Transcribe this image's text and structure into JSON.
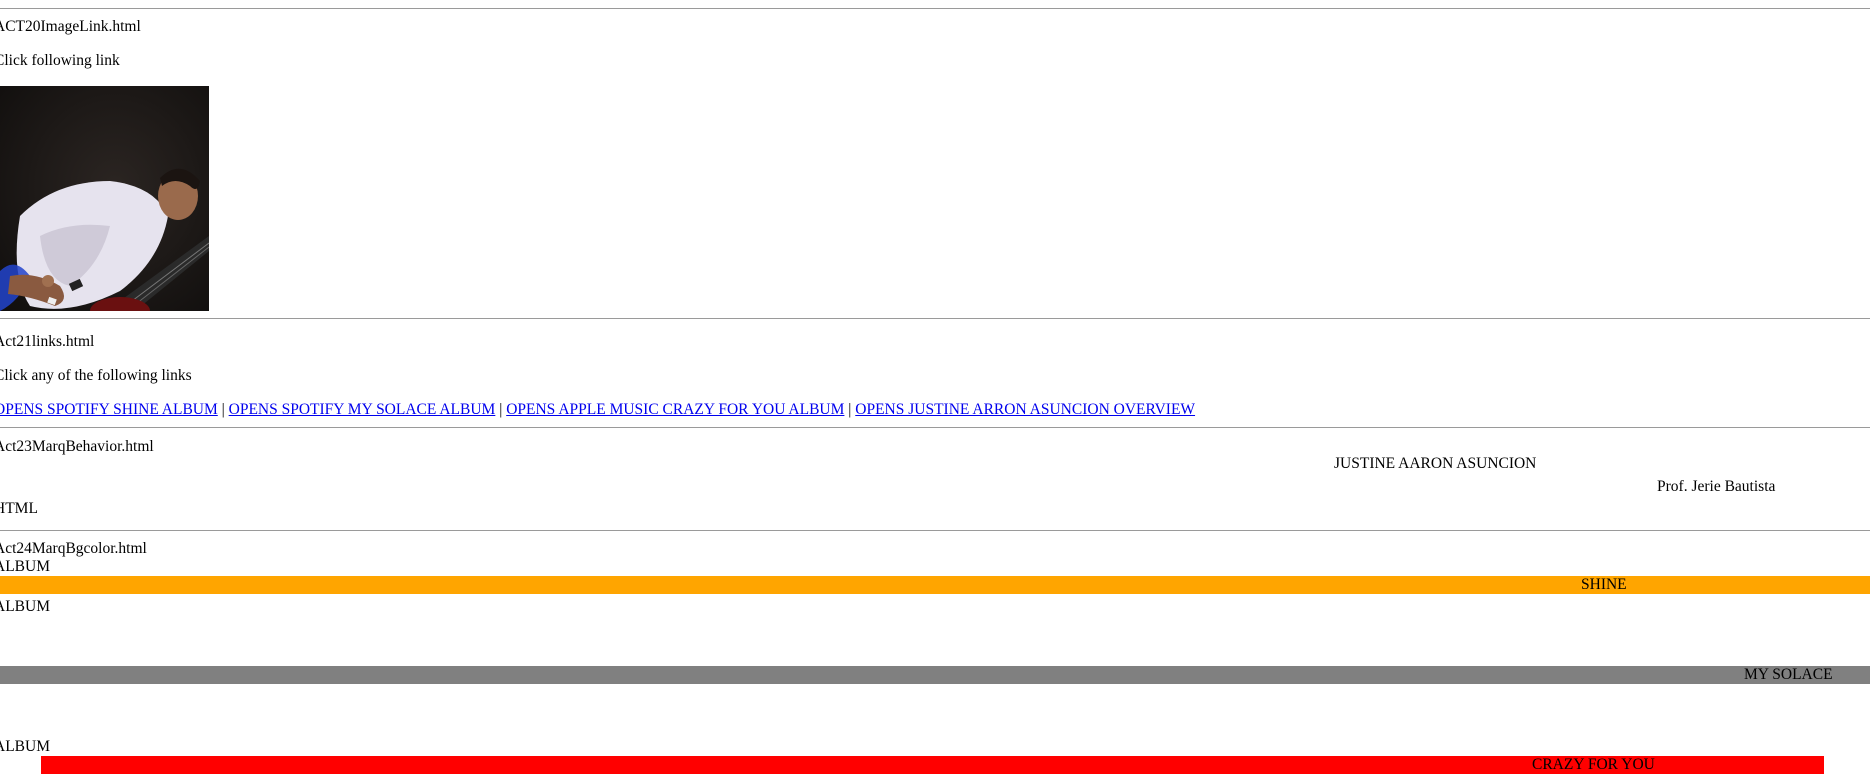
{
  "sections": {
    "s20": {
      "filename": "ACT20ImageLink.html",
      "instruction": "Click following link",
      "image_alt": "artist-photo"
    },
    "s21": {
      "filename": "Act21links.html",
      "instruction": "Click any of the following links",
      "links": [
        "OPENS SPOTIFY SHINE ALBUM",
        "OPENS SPOTIFY MY SOLACE ALBUM",
        "OPENS APPLE MUSIC CRAZY FOR YOU ALBUM",
        "OPENS JUSTINE ARRON ASUNCION OVERVIEW"
      ],
      "separator": "|"
    },
    "s23": {
      "filename": "Act23MarqBehavior.html",
      "marquee_1": "JUSTINE AARON ASUNCION",
      "marquee_2": "Prof. Jerie Bautista",
      "marquee_3": "HTML"
    },
    "s24": {
      "filename": "Act24MarqBgcolor.html",
      "albums": [
        {
          "heading": "ALBUM",
          "title": "SHINE",
          "bgcolor": "#ffa500"
        },
        {
          "heading": "ALBUM",
          "title": "MY SOLACE",
          "bgcolor": "#808080"
        },
        {
          "heading": "ALBUM",
          "title": "CRAZY FOR YOU",
          "bgcolor": "#ff0000"
        }
      ]
    }
  },
  "colors": {
    "link": "#0000ee",
    "rule": "#9a9a9a",
    "text": "#000000"
  }
}
